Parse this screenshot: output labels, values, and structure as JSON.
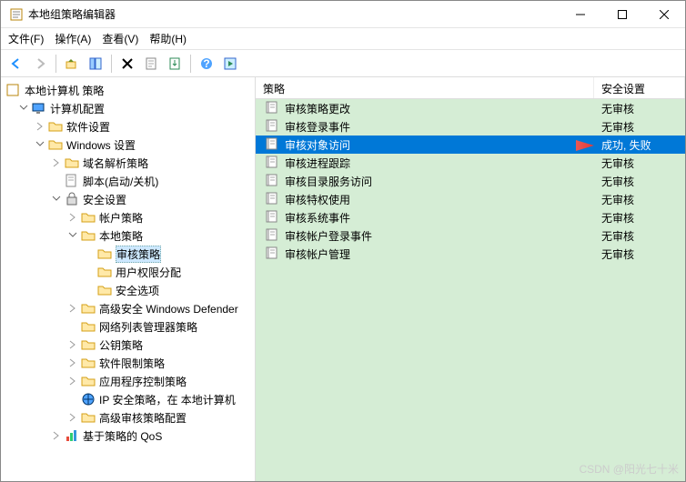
{
  "window": {
    "title": "本地组策略编辑器"
  },
  "menubar": {
    "file": "文件(F)",
    "action": "操作(A)",
    "view": "查看(V)",
    "help": "帮助(H)"
  },
  "toolbar_icons": [
    "back",
    "forward",
    "up",
    "show-hide-tree",
    "delete",
    "copy",
    "list-view",
    "refresh",
    "help",
    "play"
  ],
  "tree": {
    "root": "本地计算机 策略",
    "computer": "计算机配置",
    "software": "软件设置",
    "windows": "Windows 设置",
    "dns": "域名解析策略",
    "scripts": "脚本(启动/关机)",
    "security": "安全设置",
    "account": "帐户策略",
    "local": "本地策略",
    "audit": "审核策略",
    "userRights": "用户权限分配",
    "securityOpts": "安全选项",
    "defender": "高级安全 Windows Defender",
    "network": "网络列表管理器策略",
    "pubkey": "公钥策略",
    "softrestrict": "软件限制策略",
    "appcontrol": "应用程序控制策略",
    "ipsec": "IP 安全策略，在 本地计算机",
    "advaudit": "高级审核策略配置",
    "qos": "基于策略的 QoS"
  },
  "list": {
    "headers": {
      "policy": "策略",
      "setting": "安全设置"
    },
    "rows": [
      {
        "policy": "审核策略更改",
        "setting": "无审核"
      },
      {
        "policy": "审核登录事件",
        "setting": "无审核"
      },
      {
        "policy": "审核对象访问",
        "setting": "成功, 失败",
        "selected": true
      },
      {
        "policy": "审核进程跟踪",
        "setting": "无审核"
      },
      {
        "policy": "审核目录服务访问",
        "setting": "无审核"
      },
      {
        "policy": "审核特权使用",
        "setting": "无审核"
      },
      {
        "policy": "审核系统事件",
        "setting": "无审核"
      },
      {
        "policy": "审核帐户登录事件",
        "setting": "无审核"
      },
      {
        "policy": "审核帐户管理",
        "setting": "无审核"
      }
    ]
  },
  "watermark": "CSDN @阳光七十米"
}
